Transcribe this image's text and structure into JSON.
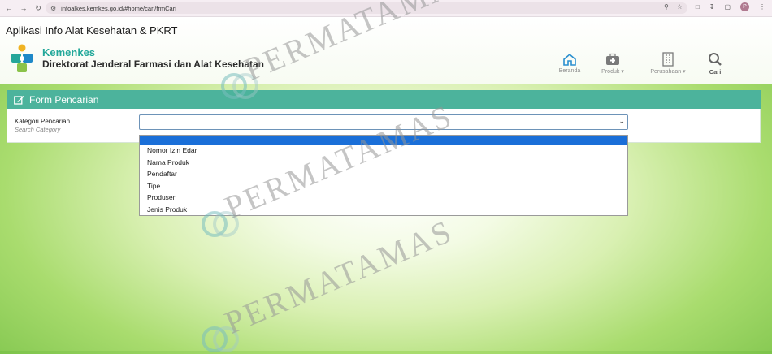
{
  "browser": {
    "url": "infoalkes.kemkes.go.id/#home/cari/frmCari",
    "avatar_initial": "P"
  },
  "header": {
    "app_title": "Aplikasi Info Alat Kesehatan & PKRT",
    "brand_name": "Kemenkes",
    "brand_subtitle": "Direktorat Jenderal Farmasi dan Alat Kesehatan"
  },
  "nav": {
    "items": [
      {
        "label": "Beranda",
        "icon": "home-icon"
      },
      {
        "label": "Produk",
        "icon": "medkit-icon",
        "dropdown": true
      },
      {
        "label": "Perusahaan",
        "icon": "building-icon",
        "dropdown": true
      },
      {
        "label": "Cari",
        "icon": "search-icon"
      }
    ]
  },
  "form": {
    "title": "Form Pencarian",
    "field_label": "Kategori Pencarian",
    "field_sublabel": "Search Category",
    "selected_value": ""
  },
  "dropdown": {
    "options": [
      "",
      "Nomor Izin Edar",
      "Nama Produk",
      "Pendaftar",
      "Tipe",
      "Produsen",
      "Jenis Produk"
    ]
  },
  "watermark": {
    "text": "PERMATAMAS"
  },
  "colors": {
    "panel_header": "#4cb39c",
    "brand_teal": "#23a89a",
    "selection": "#1a6fd8"
  }
}
